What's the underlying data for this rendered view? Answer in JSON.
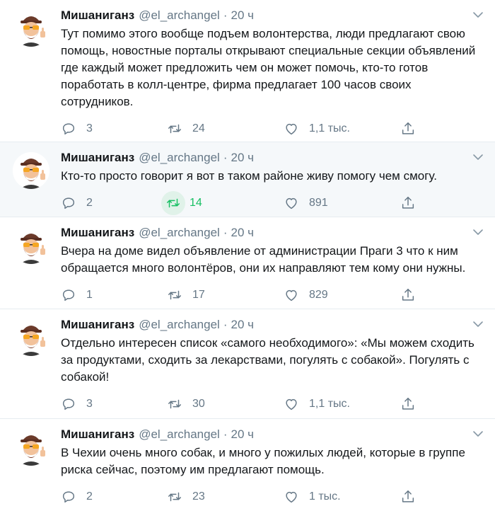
{
  "tweets": [
    {
      "name": "Мишаниганз",
      "handle": "@el_archangel",
      "sep": "·",
      "time": "20 ч",
      "text": "Тут помимо этого вообще подъем волонтерства, люди предлагают свою помощь, новостные порталы открывают специальные секции объявлений где каждый может предложить чем он может помочь, кто-то готов поработать в колл-центре, фирма предлагает 100 часов своих сотрудников.",
      "replies": "3",
      "retweets": "24",
      "likes": "1,1 тыс."
    },
    {
      "name": "Мишаниганз",
      "handle": "@el_archangel",
      "sep": "·",
      "time": "20 ч",
      "text": "Кто-то просто говорит я вот в таком районе живу помогу чем смогу.",
      "replies": "2",
      "retweets": "14",
      "likes": "891"
    },
    {
      "name": "Мишаниганз",
      "handle": "@el_archangel",
      "sep": "·",
      "time": "20 ч",
      "text": "Вчера на доме видел объявление от администрации Праги 3 что к ним обращается много волонтёров, они их направляют тем кому они нужны.",
      "replies": "1",
      "retweets": "17",
      "likes": "829"
    },
    {
      "name": "Мишаниганз",
      "handle": "@el_archangel",
      "sep": "·",
      "time": "20 ч",
      "text": "Отдельно интересен список «самого необходимого»: «Мы можем сходить за продуктами, сходить за лекарствами, погулять с собакой». Погулять с собакой!",
      "replies": "3",
      "retweets": "30",
      "likes": "1,1 тыс."
    },
    {
      "name": "Мишаниганз",
      "handle": "@el_archangel",
      "sep": "·",
      "time": "20 ч",
      "text": "В Чехии очень много собак, и много у пожилых людей, которые в группе риска сейчас, поэтому им предлагают помощь.",
      "replies": "2",
      "retweets": "23",
      "likes": "1 тыс."
    }
  ],
  "icons": {
    "reply": "reply-icon",
    "retweet": "retweet-icon",
    "like": "heart-icon",
    "share": "share-icon",
    "more": "chevron-down-icon"
  },
  "colors": {
    "text": "#14171a",
    "muted": "#657786",
    "retweet_active": "#17bf63",
    "highlight_bg": "#f5f8fa"
  }
}
